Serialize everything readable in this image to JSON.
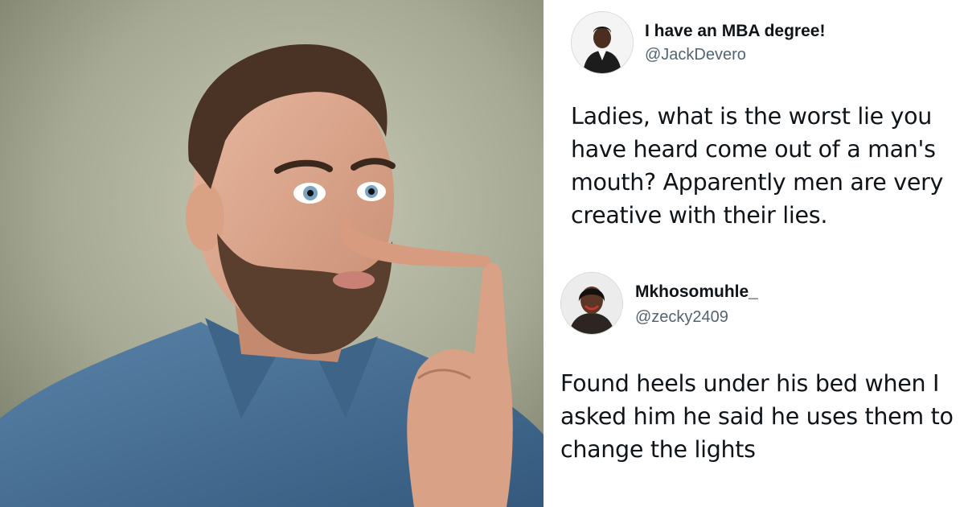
{
  "photo": {
    "alt": "man with long pinocchio nose"
  },
  "tweets": [
    {
      "display_name": "I have an MBA degree!",
      "handle": "@JackDevero",
      "text": "Ladies, what is the worst lie you have heard come out of a man's mouth? Apparently men are very creative with their lies."
    },
    {
      "display_name": "Mkhosomuhle_",
      "handle": "@zecky2409",
      "text": "Found heels under his bed when I asked him he said he uses them to change the lights"
    }
  ],
  "colors": {
    "name": "#0f1419",
    "handle": "#536471",
    "shirt": "#4a7196",
    "background_photo": "#9a9d88"
  }
}
